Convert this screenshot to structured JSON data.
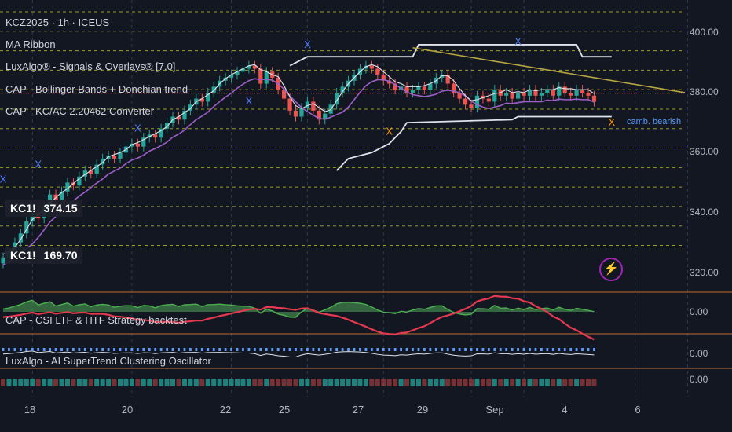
{
  "symbol_title": "KCZ2025 · 1h · ICEUS",
  "indicators": [
    "MA Ribbon",
    "LuxAlgo® - Signals & Overlays® [7.0]",
    "CAP - Bollinger Bands + Donchian trend",
    "CAP - KC/AC 2.20462 Converter"
  ],
  "badges": [
    {
      "sym": "KC1!",
      "value": "374.15"
    },
    {
      "sym": "KC1!",
      "value": "169.70"
    }
  ],
  "sub_indicators": [
    "CAP - CSI LTF & HTF Strategy backtest",
    "LuxAlgo - AI SuperTrend Clustering Oscillator"
  ],
  "annotation": "camb. bearish",
  "colors": {
    "background": "#131722",
    "bull": "#26a69a",
    "bear": "#ef5350",
    "ma_ribbon": "#9c5fc7",
    "trendline": "#b5a642",
    "channel": "#e0e3eb",
    "grid_dash": "#9a9a2a",
    "pane_border": "#c06a2a"
  },
  "chart_data": {
    "type": "candlestick",
    "price_axis": {
      "ticks": [
        "400.00",
        "380.00",
        "360.00",
        "340.00",
        "320.00"
      ],
      "ylim": [
        318,
        404
      ]
    },
    "osc_axis": {
      "ticks": [
        "0.00",
        "0.00",
        "0.00"
      ]
    },
    "x_ticks": [
      {
        "label": "18",
        "i": 5
      },
      {
        "label": "20",
        "i": 22
      },
      {
        "label": "22",
        "i": 39
      },
      {
        "label": "25",
        "i": 52
      },
      {
        "label": "27",
        "i": 65
      },
      {
        "label": "29",
        "i": 80
      },
      {
        "label": "Sep",
        "i": 89
      },
      {
        "label": "4",
        "i": 108
      },
      {
        "label": "6",
        "i": 117
      }
    ],
    "close": [
      322,
      324,
      327,
      330,
      334,
      337,
      335,
      339,
      343,
      341,
      344,
      347,
      346,
      349,
      351,
      350,
      353,
      355,
      356,
      355,
      357,
      359,
      360,
      359,
      362,
      363,
      362,
      365,
      367,
      369,
      368,
      371,
      373,
      375,
      374,
      377,
      379,
      381,
      382,
      383,
      384,
      385,
      386,
      385,
      380,
      384,
      382,
      378,
      375,
      371,
      369,
      372,
      374,
      371,
      368,
      370,
      373,
      377,
      379,
      381,
      383,
      385,
      386,
      385,
      383,
      381,
      380,
      378,
      379,
      377,
      378,
      379,
      378,
      380,
      382,
      383,
      380,
      377,
      375,
      373,
      372,
      376,
      375,
      374,
      378,
      376,
      377,
      375,
      377,
      376,
      378,
      376,
      377,
      378,
      376,
      379,
      377,
      376,
      378,
      377,
      376,
      374
    ],
    "x_marks": [
      {
        "i": 0,
        "price": 347,
        "kind": "X",
        "color": "blue"
      },
      {
        "i": 6,
        "price": 352,
        "kind": "X",
        "color": "blue"
      },
      {
        "i": 23,
        "price": 364,
        "kind": "X",
        "color": "blue"
      },
      {
        "i": 42,
        "price": 373,
        "kind": "X",
        "color": "blue"
      },
      {
        "i": 52,
        "price": 392,
        "kind": "X",
        "color": "blue"
      },
      {
        "i": 66,
        "price": 363,
        "kind": "X",
        "color": "orange"
      },
      {
        "i": 88,
        "price": 393,
        "kind": "X",
        "color": "blue"
      },
      {
        "i": 104,
        "price": 366,
        "kind": "X",
        "color": "orange"
      }
    ]
  }
}
